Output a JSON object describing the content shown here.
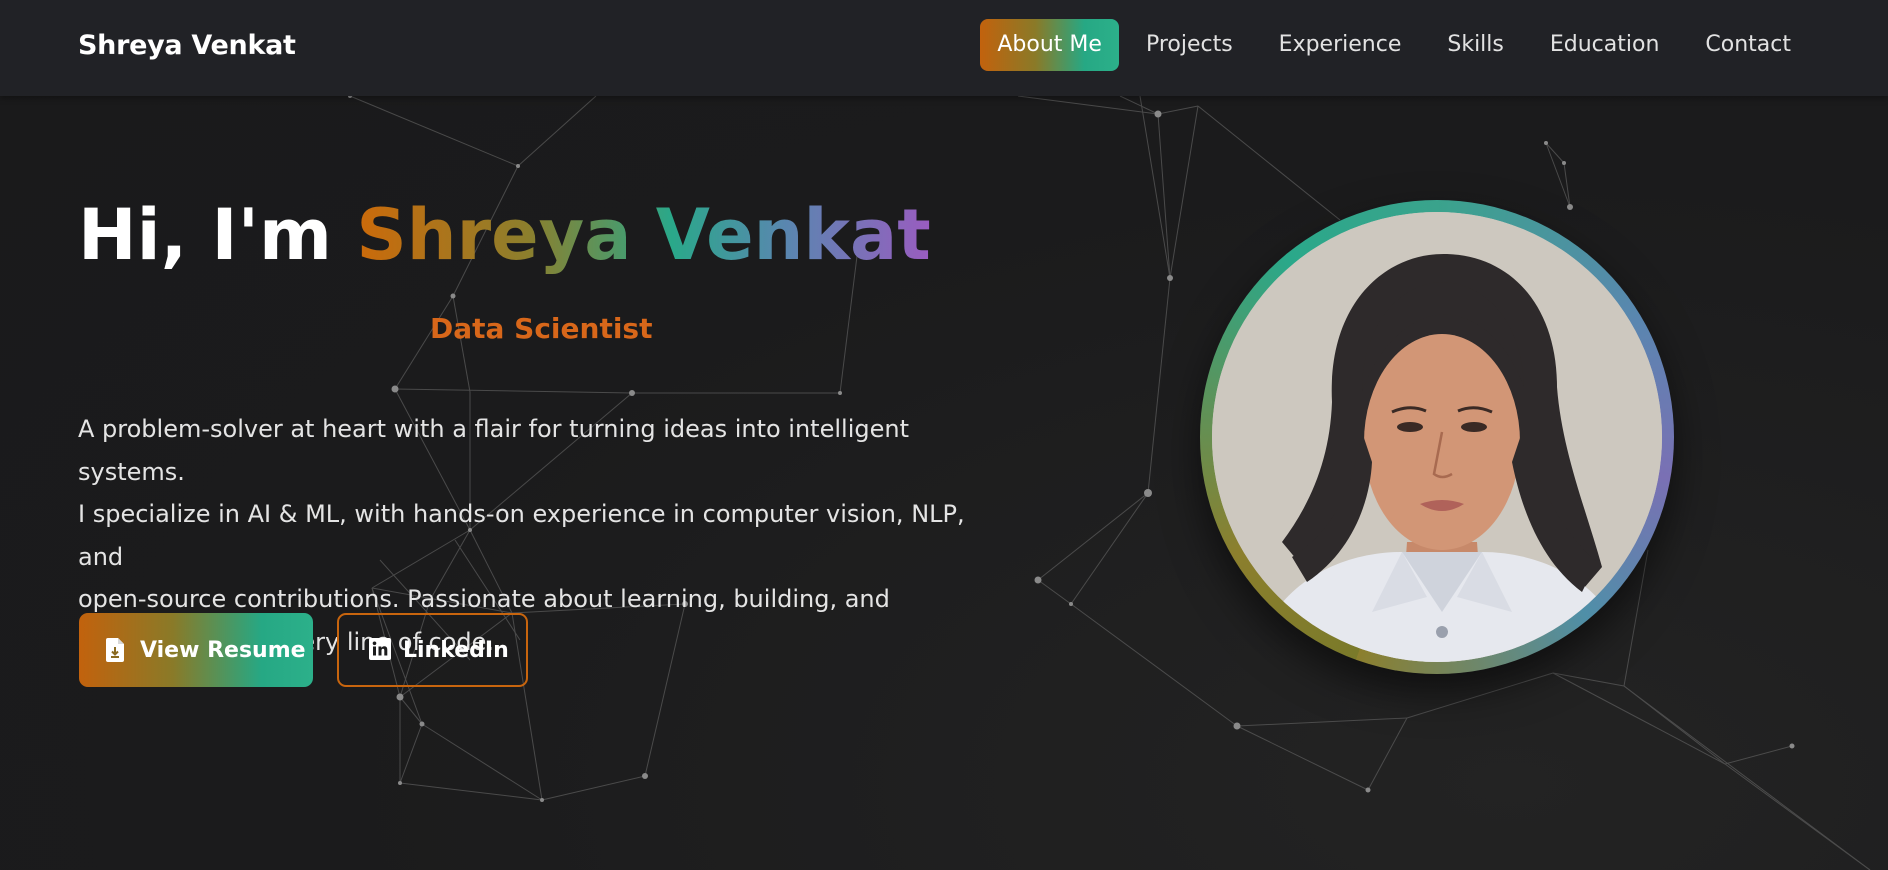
{
  "navbar": {
    "brand": "Shreya Venkat",
    "items": [
      {
        "label": "About Me",
        "active": true
      },
      {
        "label": "Projects",
        "active": false
      },
      {
        "label": "Experience",
        "active": false
      },
      {
        "label": "Skills",
        "active": false
      },
      {
        "label": "Education",
        "active": false
      },
      {
        "label": "Contact",
        "active": false
      }
    ]
  },
  "hero": {
    "greeting": "Hi, I'm ",
    "name": "Shreya Venkat",
    "role": "Data Scientist",
    "bio_lines": [
      "A problem-solver at heart with a flair for turning ideas into intelligent systems.",
      "I specialize in AI & ML, with hands-on experience in computer vision, NLP, and",
      "open-source contributions. Passionate about learning, building, and",
      "innovating with every line of code."
    ],
    "buttons": {
      "resume": {
        "label": "View Resume",
        "icon": "file-download-icon"
      },
      "linkedin": {
        "label": "LinkedIn",
        "icon": "linkedin-icon"
      }
    }
  },
  "colors": {
    "background": "#1b1b1c",
    "navbar": "#212226",
    "accent_orange": "#c8650e",
    "accent_teal": "#2aa88a",
    "accent_purple": "#9a5cc0"
  }
}
